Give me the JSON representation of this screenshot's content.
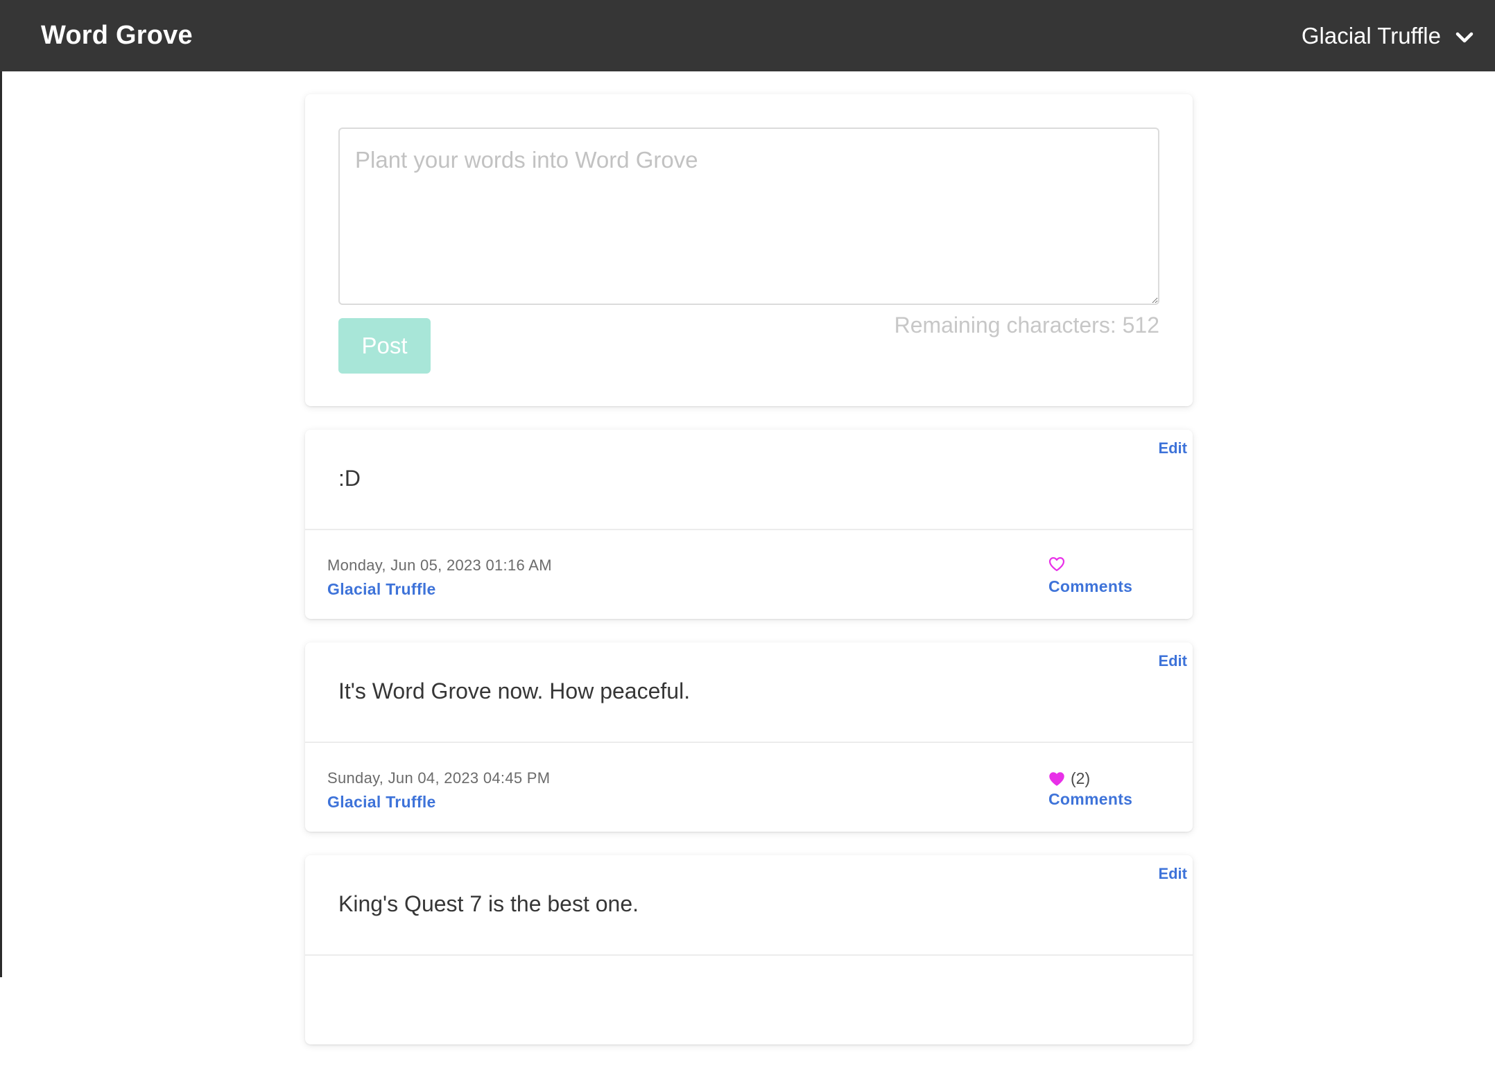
{
  "header": {
    "brand": "Word Grove",
    "user_name": "Glacial Truffle"
  },
  "composer": {
    "placeholder": "Plant your words into Word Grove",
    "value": "",
    "post_label": "Post",
    "remaining_text": "Remaining characters: 512"
  },
  "posts": [
    {
      "edit_label": "Edit",
      "text": ":D",
      "date": "Monday, Jun 05, 2023 01:16 AM",
      "author": "Glacial Truffle",
      "liked": false,
      "like_count": "",
      "comments_label": "Comments"
    },
    {
      "edit_label": "Edit",
      "text": "It's Word Grove now. How peaceful.",
      "date": "Sunday, Jun 04, 2023 04:45 PM",
      "author": "Glacial Truffle",
      "liked": true,
      "like_count": "(2)",
      "comments_label": "Comments"
    },
    {
      "edit_label": "Edit",
      "text": "King's Quest 7 is the best one."
    }
  ],
  "colors": {
    "navbar": "#363636",
    "link": "#3e73d9",
    "heart": "#e830e8",
    "post_button": "#a8e6d8"
  },
  "icons": {
    "dropdown": "chevron-down-icon",
    "like_empty": "heart-outline-icon",
    "like_filled": "heart-filled-icon"
  }
}
